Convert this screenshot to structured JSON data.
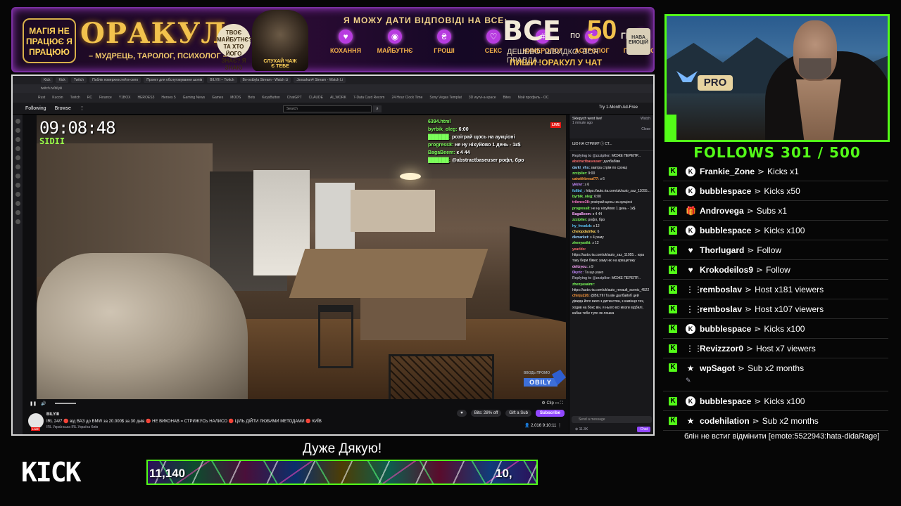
{
  "banner": {
    "badge_text": "МАГІЯ НЕ ПРАЦЮЄ Я ПРАЦЮЮ",
    "title": "ОРАКУЛ",
    "subtitle": "– МУДРЕЦЬ, ТАРОЛОГ, ПСИХОЛОГ –",
    "question_bubble": "ТВОЄ МАЙБУТНЄ? ТА ХТО ЙОГО ЗНАЄ? Я ЗНАЮ",
    "ball_text": "СЛУХАЙ ЧАЖ Є ТЕБЕ",
    "headline": "Я МОЖУ ДАТИ ВІДПОВІДІ НА ВСЕ:",
    "topics": [
      {
        "icon": "heart-icon",
        "label": "КОХАННЯ"
      },
      {
        "icon": "eye-icon",
        "label": "МАЙБУТНЄ"
      },
      {
        "icon": "money-icon",
        "label": "ГРОШІ"
      },
      {
        "icon": "sex-icon",
        "label": "СЕКС"
      },
      {
        "icon": "numerology-icon",
        "label": "НУМЕРОЛОГ"
      },
      {
        "icon": "moon-icon",
        "label": "АСТРОЛОГ"
      },
      {
        "icon": "brain-icon",
        "label": "ПСИХОЛОГ"
      }
    ],
    "price_all": "ВСЕ",
    "price_po": "по",
    "price_value": "50",
    "price_currency": "ГРН.",
    "tagline": "ДЕШЕВО. ШВИДКО. ВСЯ ПРАВДА.",
    "cta": "ПИШИ !ОРАКУЛ У ЧАТ",
    "cup_text": "НАВА ЕМОЦІЙ"
  },
  "browser": {
    "tabs": [
      "Kick",
      "Kick",
      "Twitch",
      "Паблік поверхностей в-село",
      "Проект для обслуговування шопів",
      "BILYIII – Twitch",
      "Bo-ostbyla Stream - Watch Li",
      "Jsouahun4 Stream - Watch Li"
    ],
    "address": "twitch.tv/bilyiii",
    "bookmarks": [
      "Rust",
      "Kucoin",
      "Twitch",
      "RC",
      "Finance",
      "Y1BOX",
      "HEROES3",
      "Heroes 5",
      "Gaming News",
      "Games",
      "MODS",
      "Bots",
      "KeysButton",
      "ChatGPT",
      "CLAUDE",
      "AI_WORK",
      "7-Data Card Recom",
      "24 Hour Clock Time",
      "Sony Vegas Templat",
      "3D wyrvi-a-space",
      "Bites",
      "Мой профиль - ОС"
    ]
  },
  "twitch_nav": {
    "following": "Following",
    "browse": "Browse",
    "more": "⋮",
    "search_placeholder": "Search",
    "promo": "Try 1-Month Ad-Free"
  },
  "video": {
    "clock": "09:08:48",
    "tag": "SIDII",
    "overlay_chat": [
      {
        "user": "6394.html",
        "msg": ""
      },
      {
        "user": "byrbik_oleg:",
        "msg": "6:00"
      },
      {
        "user": "██████:",
        "msg": "розіграй щось на аукціоні"
      },
      {
        "user": "progress8:",
        "msg": "не ну ніхуйово 1 день - 1к$"
      },
      {
        "user": "BagaBeem:",
        "msg": "к 4 44"
      },
      {
        "user": "██████:",
        "msg": "@abstractbaseuser рофл, бро"
      }
    ],
    "live_badge": "LIVE",
    "watermark_top": "ВВОДЬ ПРОМО",
    "watermark_brand": "OBILY"
  },
  "controls": {
    "play": "❚❚",
    "volume": "🔊",
    "right": "⚙ Clip ▭ ⛶"
  },
  "stream_info": {
    "live": "LIVE",
    "name": "BILYIII",
    "title": "IRL 24/7 🔴 від ВАЗ до BMW за 20.000$ за 30 днів 🔴 НЕ ВИКОНАВ = СТРИЖУСЬ НАЛИСО 🔴 ЦІЛЬ ДІЙТИ ЛЮБИМИ МЕТОДАМИ 🔴 КИЇВ",
    "tags": "IRL  Українська  IRL  Україна  Київ",
    "bits": "Bits: 28% off",
    "gift": "Gift a Sub",
    "subscribe": "Subscribe",
    "stats": "👤 2,016   9:10:11  ⋮"
  },
  "twitch_chat": {
    "notice": "Sklepych went live!",
    "notice_time": "1 minute ago",
    "watch": "Watch",
    "close": "Close",
    "pinned": "ШО НА СТРИМ? ⓘ СТ...",
    "messages": [
      {
        "user": "Replying to @zzziplier:",
        "text": "МОЖЕ ПЕРЕПР...",
        "color": "#adadb8"
      },
      {
        "user": "abstractbaseuser:",
        "text": "далбабіви",
        "color": "#ff6f6f"
      },
      {
        "user": "darkl_vhs:",
        "text": "завтра стрім по срокцi",
        "color": "#9ad5ff"
      },
      {
        "user": "zzziplier:",
        "text": "9:00",
        "color": "#7bff5a"
      },
      {
        "user": "catwithbread77:",
        "text": "з 6",
        "color": "#ff9a3c"
      },
      {
        "user": "ykklvr:",
        "text": "з 6",
        "color": "#c58cff"
      },
      {
        "user": "fulibd_:",
        "text": "https://auto.ria.com/uk/auto_zaz_11055...",
        "color": "#5ecbff"
      },
      {
        "user": "byrbik_oleg:",
        "text": "6:00",
        "color": "#7bff5a"
      },
      {
        "user": "trilence38:",
        "text": "розіграй щось на аукціоні",
        "color": "#ff7acb"
      },
      {
        "user": "progress8:",
        "text": "не ну ніхуйово 1 день - 1к$",
        "color": "#7bff5a"
      },
      {
        "user": "BagaBeem:",
        "text": "к 4 44",
        "color": "#ffa8ff"
      },
      {
        "user": "zzziplier:",
        "text": "рофл, бро",
        "color": "#7bff5a"
      },
      {
        "user": "hy_freudzk:",
        "text": "з 12",
        "color": "#5ecbff"
      },
      {
        "user": "chelopdatrika:",
        "text": "6",
        "color": "#ffd35a"
      },
      {
        "user": "dkmarket:",
        "text": "з 4 раму",
        "color": "#9ad5ff"
      },
      {
        "user": "zhenyasiki:",
        "text": "з 12",
        "color": "#7bff5a"
      },
      {
        "user": "yearldo:",
        "text": "https://auto.ria.com/uk/auto_zaz_11055... юра таку бери бімес заму ню на крвщитику",
        "color": "#ff6f6f"
      },
      {
        "user": "deltzyou:",
        "text": "з 9",
        "color": "#ffa8ff"
      },
      {
        "user": "0kyric:",
        "text": "Та що ушко",
        "color": "#c58cff"
      },
      {
        "user": "Replying to @zzziplier:",
        "text": "МОЖЕ ПЕРЕПР...",
        "color": "#adadb8"
      },
      {
        "user": "zhenyasaimr:",
        "text": "https://auto.ria.com/uk/auto_renault_scenic_4522",
        "color": "#7bff5a"
      },
      {
        "user": "chinju226:",
        "text": "@BILYIII Та він далбайоб цей дівида його вихо з дитинства, з камінця тех, ходив на бокс він, я нього всі мозги відбилі, кабає тебе тупо як лошка",
        "color": "#ff9a3c"
      }
    ],
    "send_placeholder": "Send a message",
    "footer": "⊕ 11.3K",
    "chat_btn": "Chat"
  },
  "bottom": {
    "kick_logo": "KICK",
    "thanks": "Дуже Дякую!",
    "goal_left": "11,140",
    "goal_right": "10,"
  },
  "webcam": {
    "sign": "PRO"
  },
  "follows_header": "FOLLOWS 301 / 500",
  "events": [
    {
      "icon": "kick-coin-icon",
      "name": "Frankie_Zone",
      "action": "Kicks x1"
    },
    {
      "icon": "kick-coin-icon",
      "name": "bubblespace",
      "action": "Kicks x50"
    },
    {
      "icon": "gift-icon",
      "name": "Androvega",
      "action": "Subs x1"
    },
    {
      "icon": "kick-coin-icon",
      "name": "bubblespace",
      "action": "Kicks x100"
    },
    {
      "icon": "heart-icon",
      "name": "Thorlugard",
      "action": "Follow"
    },
    {
      "icon": "heart-icon",
      "name": "Krokodeilos9",
      "action": "Follow"
    },
    {
      "icon": "host-icon",
      "name": "remboslav",
      "action": "Host x181 viewers"
    },
    {
      "icon": "host-icon",
      "name": "remboslav",
      "action": "Host x107 viewers"
    },
    {
      "icon": "kick-coin-icon",
      "name": "bubblespace",
      "action": "Kicks x100"
    },
    {
      "icon": "host-icon",
      "name": "Revizzzor0",
      "action": "Host x7 viewers"
    },
    {
      "icon": "star-icon",
      "name": "wpSagot",
      "action": "Sub x2 months"
    },
    {
      "icon": "kick-coin-icon",
      "name": "bubblespace",
      "action": "Kicks x100"
    },
    {
      "icon": "star-icon",
      "name": "codehilation",
      "action": "Sub x2 months"
    }
  ],
  "event_message": "блін не встиг відмінити [emote:5522943:hata-didaRage]",
  "sep": "⋗"
}
